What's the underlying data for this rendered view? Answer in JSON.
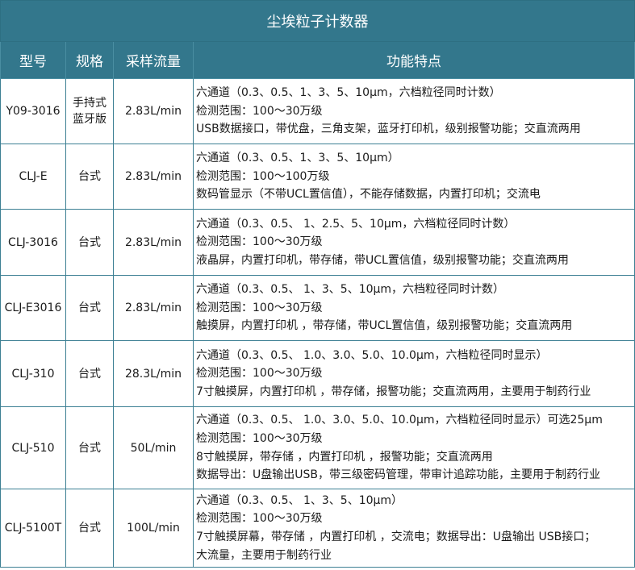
{
  "title": "尘埃粒子计数器",
  "headers": {
    "model": "型号",
    "spec": "规格",
    "flow": "采样流量",
    "features": "功能特点"
  },
  "rows": [
    {
      "model": "Y09-3016",
      "spec": [
        "手持式",
        "蓝牙版"
      ],
      "flow": "2.83L/min",
      "features": [
        "六通道（0.3、0.5、1、3、5、10μm，六档粒径同时计数）",
        "检测范围：100～30万级",
        "USB数据接口，带优盘，三角支架，蓝牙打印机，级别报警功能；交直流两用"
      ]
    },
    {
      "model": "CLJ-E",
      "spec": [
        "台式"
      ],
      "flow": "2.83L/min",
      "features": [
        "六通道（0.3、0.5、1、3、5、10μm）",
        "检测范围：100～100万级",
        "数码管显示（不带UCL置信值），不能存储数据，内置打印机；交流电"
      ]
    },
    {
      "model": "CLJ-3016",
      "spec": [
        "台式"
      ],
      "flow": "2.83L/min",
      "features": [
        "六通道（0.3、0.5、 1、2.5、5、10μm，六档粒径同时计数）",
        "检测范围：100～30万级",
        "液晶屏，内置打印机，带存储，带UCL置信值，级别报警功能；交直流两用"
      ]
    },
    {
      "model": "CLJ-E3016",
      "spec": [
        "台式"
      ],
      "flow": "2.83L/min",
      "features": [
        "六通道（0.3、0.5、 1、3、5、10μm，六档粒径同时计数）",
        "检测范围：100～30万级",
        "触摸屏，内置打印机 ，带存储，带UCL置信值，级别报警功能；交直流两用"
      ]
    },
    {
      "model": "CLJ-310",
      "spec": [
        "台式"
      ],
      "flow": "28.3L/min",
      "features": [
        "六通道（0.3、0.5、 1.0、3.0、5.0、10.0μm，六档粒径同时显示）",
        "检测范围：100～30万级",
        "7寸触摸屏，内置打印机 ，带存储，报警功能；交直流两用，主要用于制药行业"
      ]
    },
    {
      "model": "CLJ-510",
      "spec": [
        "台式"
      ],
      "flow": "50L/min",
      "features": [
        "六通道（0.3、0.5、 1.0、3.0、5.0、10.0μm，六档粒径同时显示）可选25μm",
        "检测范围：100～30万级",
        "8寸触摸屏，带存储 ，内置打印机 ，报警功能；交直流两用",
        "数据导出：U盘输出USB，带三级密码管理，带审计追踪功能，主要用于制药行业"
      ]
    },
    {
      "model": "CLJ-5100T",
      "spec": [
        "台式"
      ],
      "flow": "100L/min",
      "features": [
        "六通道（0.3、0.5、 1、3、5、10μm）",
        "检测范围：100～30万级",
        "7寸触摸屏幕，带存储 ，内置打印机 ，交流电；数据导出：U盘输出 USB接口；",
        "大流量，主要用于制药行业"
      ]
    }
  ]
}
